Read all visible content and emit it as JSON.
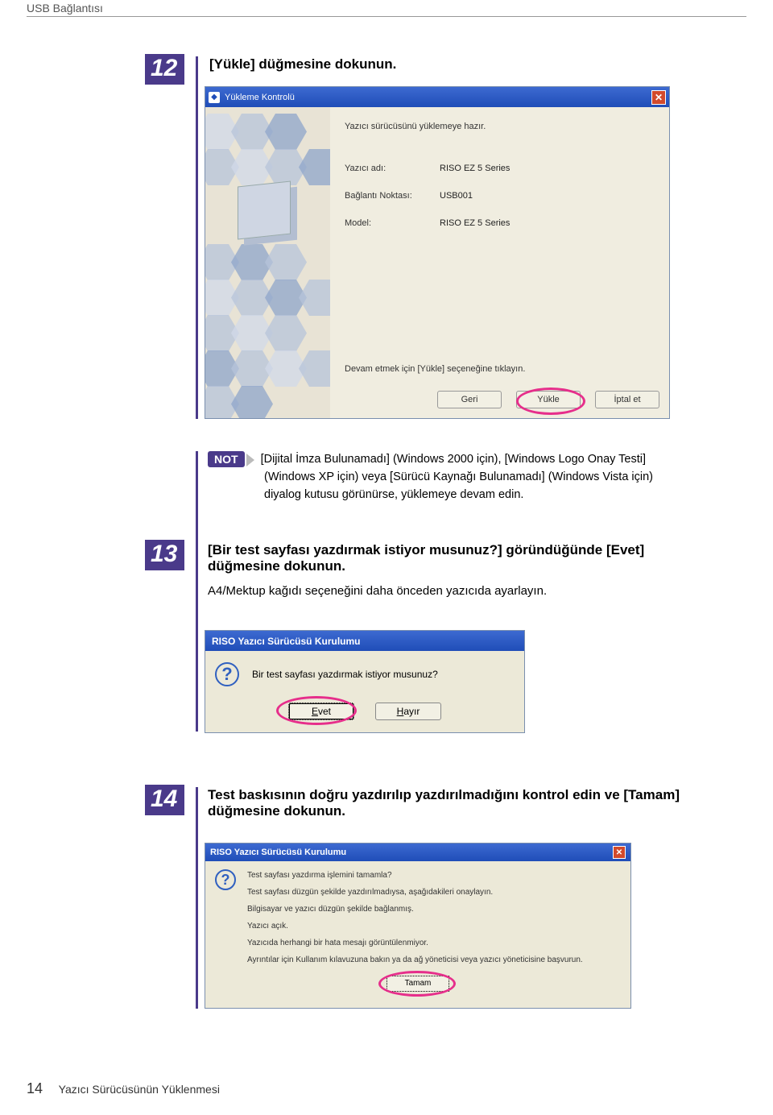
{
  "header": "USB Bağlantısı",
  "step12": {
    "num": "12",
    "instruction": "[Yükle] düğmesine dokunun."
  },
  "screenshot1": {
    "title": "Yükleme Kontrolü",
    "topline": "Yazıcı sürücüsünü yüklemeye hazır.",
    "fields": {
      "printer_label": "Yazıcı adı:",
      "printer_value": "RISO EZ 5 Series",
      "port_label": "Bağlantı Noktası:",
      "port_value": "USB001",
      "model_label": "Model:",
      "model_value": "RISO EZ 5 Series"
    },
    "note": "Devam etmek için [Yükle] seçeneğine tıklayın.",
    "buttons": {
      "back": "Geri",
      "install": "Yükle",
      "cancel": "İptal et"
    }
  },
  "note_badge": "NOT",
  "note_text_lines": [
    "[Dijital İmza Bulunamadı] (Windows 2000 için), [Windows Logo Onay Testi]",
    "(Windows XP için) veya [Sürücü Kaynağı Bulunamadı] (Windows Vista için)",
    "diyalog kutusu görünürse, yüklemeye devam edin."
  ],
  "step13": {
    "num": "13",
    "instruction1": "[Bir test sayfası yazdırmak istiyor musunuz?] göründüğünde [Evet] düğmesine dokunun.",
    "sub": "A4/Mektup kağıdı seçeneğini daha önceden yazıcıda ayarlayın."
  },
  "screenshot2": {
    "title": "RISO Yazıcı Sürücüsü Kurulumu",
    "question": "Bir test sayfası yazdırmak istiyor musunuz?",
    "yes": "Evet",
    "no": "Hayır"
  },
  "step14": {
    "num": "14",
    "instruction": "Test baskısının doğru yazdırılıp yazdırılmadığını kontrol edin ve [Tamam] düğmesine dokunun."
  },
  "screenshot3": {
    "title": "RISO Yazıcı Sürücüsü Kurulumu",
    "line1": "Test sayfası yazdırma işlemini tamamla?",
    "line2": "Test sayfası düzgün şekilde yazdırılmadıysa, aşağıdakileri onaylayın.",
    "line3": "Bilgisayar ve yazıcı düzgün şekilde bağlanmış.",
    "line4": "Yazıcı açık.",
    "line5": "Yazıcıda herhangi bir hata mesajı görüntülenmiyor.",
    "line6": "Ayrıntılar için Kullanım kılavuzuna bakın ya da ağ yöneticisi veya yazıcı yöneticisine başvurun.",
    "ok": "Tamam"
  },
  "footer": {
    "page": "14",
    "text": "Yazıcı Sürücüsünün Yüklenmesi"
  }
}
